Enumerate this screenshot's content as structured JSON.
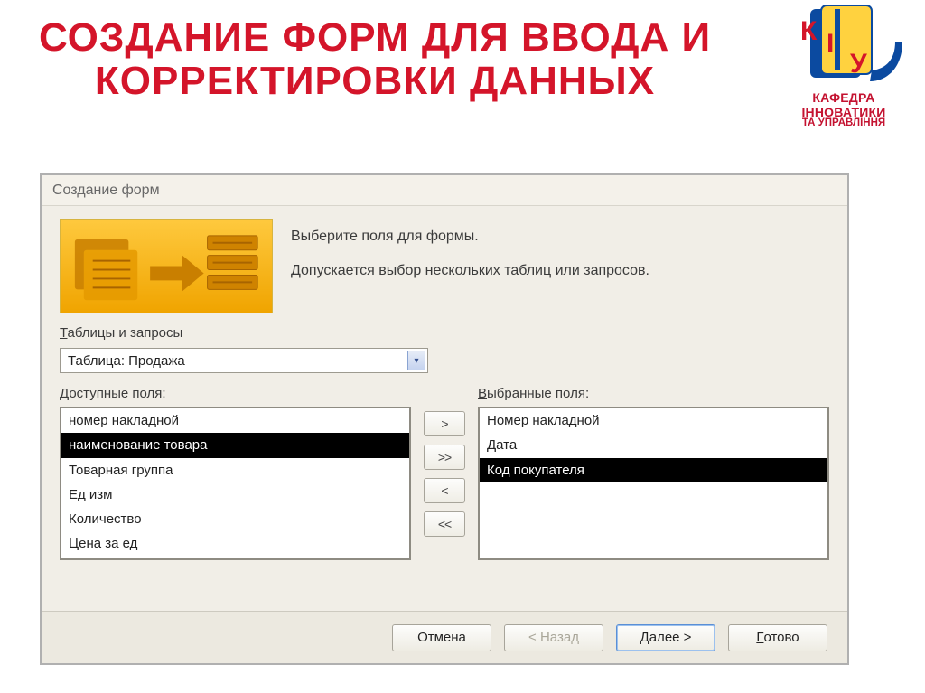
{
  "slide": {
    "title": "СОЗДАНИЕ ФОРМ ДЛЯ ВВОДА И КОРРЕКТИРОВКИ ДАННЫХ"
  },
  "logo": {
    "line1": "КАФЕДРА ІННОВАТИКИ",
    "line2": "ТА УПРАВЛІННЯ"
  },
  "dialog": {
    "title": "Создание форм",
    "hero_line1": "Выберите поля для формы.",
    "hero_line2": "Допускается выбор нескольких таблиц или запросов.",
    "tables_label_pre": "Т",
    "tables_label_rest": "аблицы и запросы",
    "combo_value": "Таблица: Продажа",
    "available_label_pre": "Д",
    "available_label_rest": "оступные поля:",
    "selected_label_pre": "В",
    "selected_label_rest": "ыбранные поля:",
    "available_fields": [
      {
        "label": "номер накладной",
        "selected": false
      },
      {
        "label": "наименование товара",
        "selected": true
      },
      {
        "label": "Товарная группа",
        "selected": false
      },
      {
        "label": "Ед изм",
        "selected": false
      },
      {
        "label": "Количество",
        "selected": false
      },
      {
        "label": "Цена за ед",
        "selected": false
      }
    ],
    "selected_fields": [
      {
        "label": "Номер накладной",
        "selected": false
      },
      {
        "label": "Дата",
        "selected": false
      },
      {
        "label": "Код покупателя",
        "selected": true
      }
    ],
    "move_buttons": {
      "add": ">",
      "add_all": ">>",
      "remove": "<",
      "remove_all": "<<"
    },
    "buttons": {
      "cancel": "Отмена",
      "back": "< Назад",
      "next": "Далее >",
      "finish_u": "Г",
      "finish_rest": "отово"
    }
  }
}
